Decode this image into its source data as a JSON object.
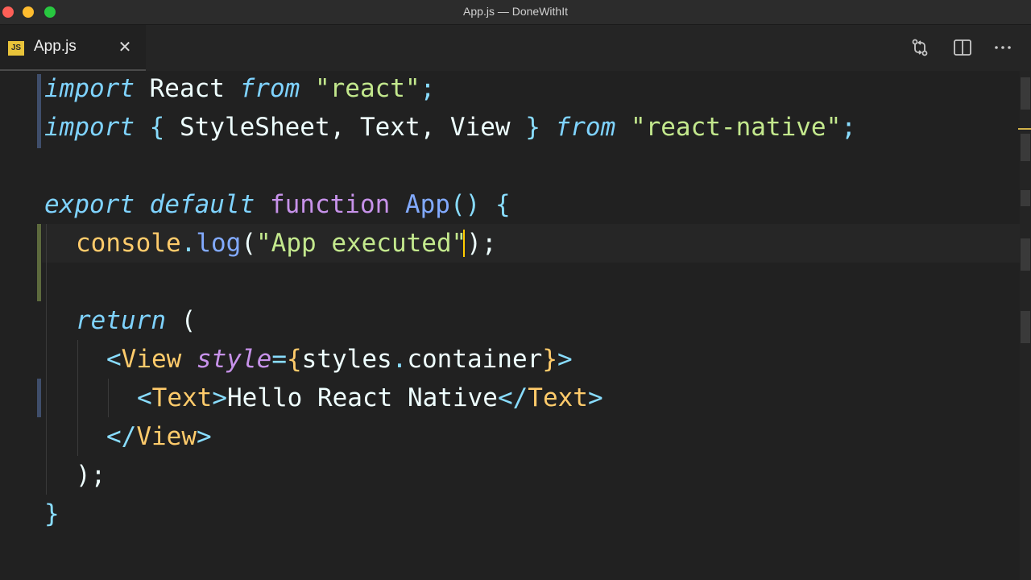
{
  "window": {
    "title": "App.js — DoneWithIt"
  },
  "tab": {
    "icon_text": "JS",
    "label": "App.js",
    "close_glyph": "✕"
  },
  "actions": {
    "compare_icon": "git-compare-icon",
    "split_icon": "split-editor-icon",
    "more_icon": "more-actions-icon"
  },
  "code": {
    "l1": {
      "kw_import": "import",
      "react": " React ",
      "kw_from": "from",
      "sp": " ",
      "str": "\"react\"",
      "semi": ";"
    },
    "l2": {
      "kw_import": "import",
      "sp1": " ",
      "open": "{",
      "names": " StyleSheet, Text, View ",
      "close": "}",
      "sp2": " ",
      "kw_from": "from",
      "sp3": " ",
      "str": "\"react-native\"",
      "semi": ";"
    },
    "l4": {
      "kw_export": "export",
      "sp1": " ",
      "kw_default": "default",
      "sp2": " ",
      "kw_function": "function",
      "sp3": " ",
      "name": "App",
      "parens": "()",
      "sp4": " ",
      "brace": "{"
    },
    "l5": {
      "obj": "console",
      "dot": ".",
      "method": "log",
      "open": "(",
      "str": "\"App executed\"",
      "close": ");"
    },
    "l7": {
      "kw_return": "return",
      "sp": " ",
      "paren": "("
    },
    "l8": {
      "lt": "<",
      "tag": "View",
      "sp": " ",
      "attr": "style",
      "eq": "=",
      "open": "{",
      "value": "styles",
      "dot": ".",
      "prop": "container",
      "close": "}",
      "gt": ">"
    },
    "l9": {
      "lt": "<",
      "tag": "Text",
      "gt": ">",
      "text": "Hello React Native",
      "lt_close": "</",
      "tag_close": "Text",
      "gt_close": ">"
    },
    "l10": {
      "lt": "</",
      "tag": "View",
      "gt": ">"
    },
    "l11": {
      "text": ");"
    },
    "l12": {
      "text": "}"
    }
  },
  "colors": {
    "editor_bg": "#212121",
    "keyword": "#7fd3ff",
    "function_keyword": "#c792ea",
    "string": "#c3e88d",
    "tag": "#ffcb6b",
    "cursor": "#ffcc00"
  }
}
